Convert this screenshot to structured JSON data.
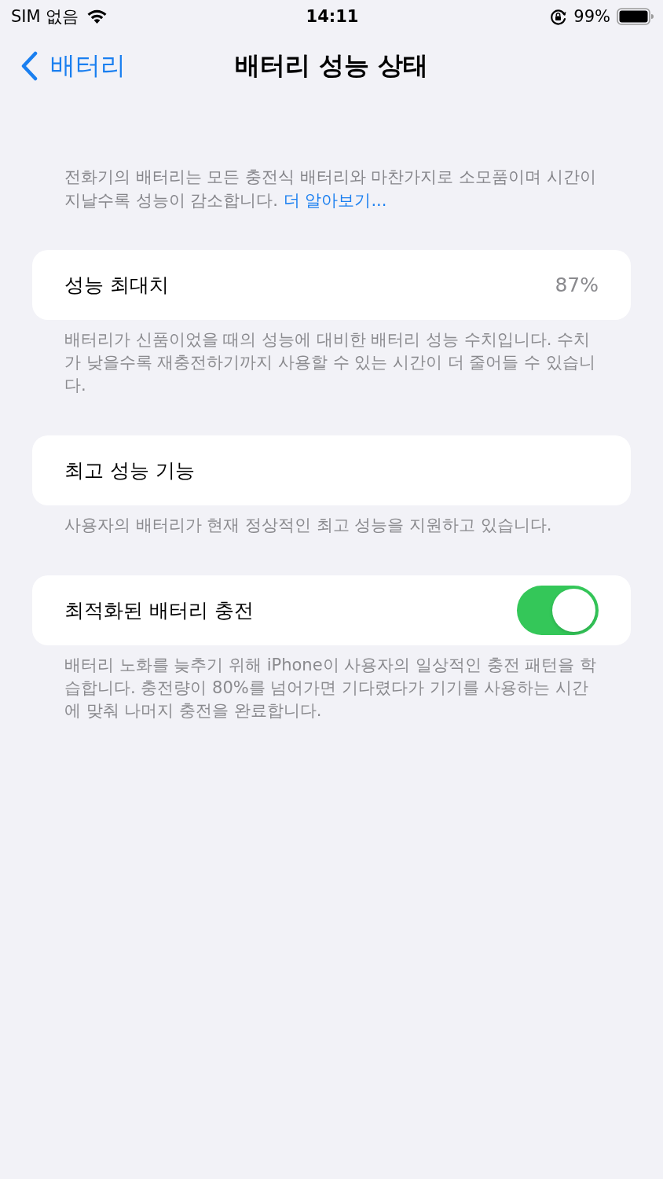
{
  "status_bar": {
    "carrier": "SIM 없음",
    "time": "14:11",
    "battery_percent": "99%"
  },
  "nav": {
    "back_label": "배터리",
    "title": "배터리 성능 상태"
  },
  "intro": {
    "text": "전화기의 배터리는 모든 충전식 배터리와 마찬가지로 소모품이며 시간이 지날수록 성능이 감소합니다.",
    "link": "더 알아보기..."
  },
  "sections": [
    {
      "kind": "value",
      "label": "성능 최대치",
      "value": "87%",
      "footer": "배터리가 신품이었을 때의 성능에 대비한 배터리 성능 수치입니다. 수치가 낮을수록 재충전하기까지 사용할 수 있는 시간이 더 줄어들 수 있습니다."
    },
    {
      "kind": "plain",
      "label": "최고 성능 기능",
      "footer": "사용자의 배터리가 현재 정상적인 최고 성능을 지원하고 있습니다."
    },
    {
      "kind": "toggle",
      "label": "최적화된 배터리 충전",
      "on": true,
      "footer": "배터리 노화를 늦추기 위해 iPhone이 사용자의 일상적인 충전 패턴을 학습합니다. 충전량이 80%를 넘어가면 기다렸다가 기기를 사용하는 시간에 맞춰 나머지 충전을 완료합니다."
    }
  ]
}
